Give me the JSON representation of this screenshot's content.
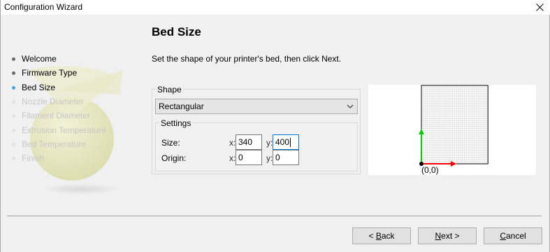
{
  "window": {
    "title": "Configuration Wizard"
  },
  "steps": [
    {
      "label": "Welcome",
      "state": "done"
    },
    {
      "label": "Firmware Type",
      "state": "done"
    },
    {
      "label": "Bed Size",
      "state": "current"
    },
    {
      "label": "Nozzle Diameter",
      "state": "todo"
    },
    {
      "label": "Filament Diameter",
      "state": "todo"
    },
    {
      "label": "Extrusion Temperature",
      "state": "todo"
    },
    {
      "label": "Bed Temperature",
      "state": "todo"
    },
    {
      "label": "Finish",
      "state": "todo"
    }
  ],
  "page": {
    "title": "Bed Size",
    "description": "Set the shape of your printer's bed, then click Next."
  },
  "shape": {
    "group_label": "Shape",
    "selected": "Rectangular",
    "settings_label": "Settings",
    "size_label": "Size:",
    "origin_label": "Origin:",
    "x_label": "x:",
    "y_label": "y:",
    "size_x": "340",
    "size_y": "400",
    "origin_x": "0",
    "origin_y": "0"
  },
  "preview": {
    "origin_text": "(0,0)",
    "bed_width": 340,
    "bed_depth": 400,
    "colors": {
      "x_axis": "#ff0000",
      "y_axis": "#00cc00",
      "grid": "#c8c8c8",
      "border": "#000000"
    }
  },
  "buttons": {
    "back": {
      "prefix": "< ",
      "accel": "B",
      "rest": "ack"
    },
    "next": {
      "prefix": "",
      "accel": "N",
      "rest": "ext >"
    },
    "cancel": {
      "prefix": "",
      "accel": "C",
      "rest": "ancel"
    }
  },
  "colors": {
    "current_step_bullet": "#4aa3df",
    "focus_border": "#0078d7"
  }
}
